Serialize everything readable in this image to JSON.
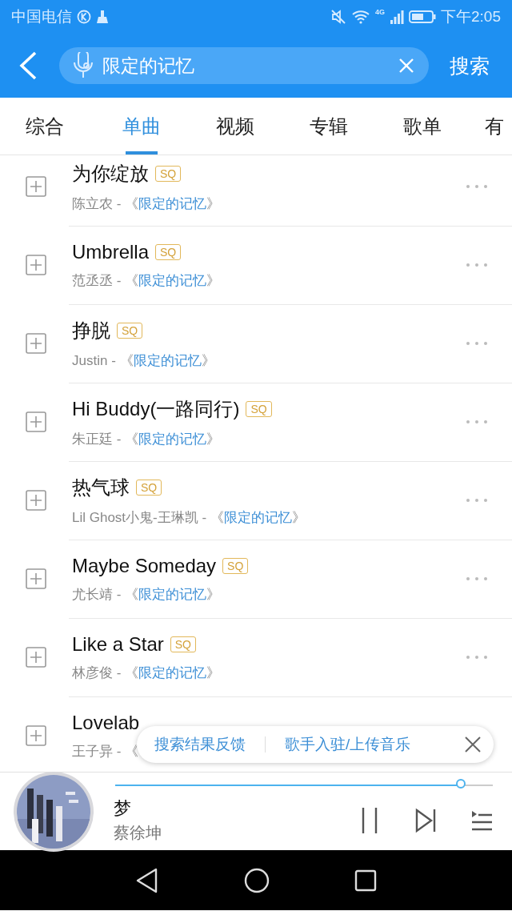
{
  "status_bar": {
    "carrier": "中国电信",
    "network": "4G",
    "time": "下午2:05"
  },
  "search": {
    "value": "限定的记忆",
    "button": "搜索"
  },
  "tabs": [
    {
      "label": "综合",
      "selected": false
    },
    {
      "label": "单曲",
      "selected": true
    },
    {
      "label": "视频",
      "selected": false
    },
    {
      "label": "专辑",
      "selected": false
    },
    {
      "label": "歌单",
      "selected": false
    },
    {
      "label": "有",
      "selected": false
    }
  ],
  "songs": [
    {
      "title": "为你绽放",
      "badge": "SQ",
      "artist": "陈立农 - 《",
      "album": "限定的记忆",
      "suffix": "》"
    },
    {
      "title": "Umbrella",
      "badge": "SQ",
      "artist": "范丞丞 - 《",
      "album": "限定的记忆",
      "suffix": "》"
    },
    {
      "title": "挣脱",
      "badge": "SQ",
      "artist": "Justin - 《",
      "album": "限定的记忆",
      "suffix": "》"
    },
    {
      "title": "Hi Buddy(一路同行)",
      "badge": "SQ",
      "artist": "朱正廷 - 《",
      "album": "限定的记忆",
      "suffix": "》"
    },
    {
      "title": "热气球",
      "badge": "SQ",
      "artist": "Lil Ghost小鬼-王琳凯 - 《",
      "album": "限定的记忆",
      "suffix": "》"
    },
    {
      "title": "Maybe Someday",
      "badge": "SQ",
      "artist": "尤长靖 - 《",
      "album": "限定的记忆",
      "suffix": "》"
    },
    {
      "title": "Like a Star",
      "badge": "SQ",
      "artist": "林彦俊 - 《",
      "album": "限定的记忆",
      "suffix": "》"
    },
    {
      "title": "Lovelab",
      "artist": "王子异 - 《"
    }
  ],
  "feedback": {
    "links": [
      "搜索结果反馈",
      "歌手入驻/上传音乐"
    ]
  },
  "player": {
    "title": "梦",
    "artist": "蔡徐坤",
    "level": 0.92
  }
}
